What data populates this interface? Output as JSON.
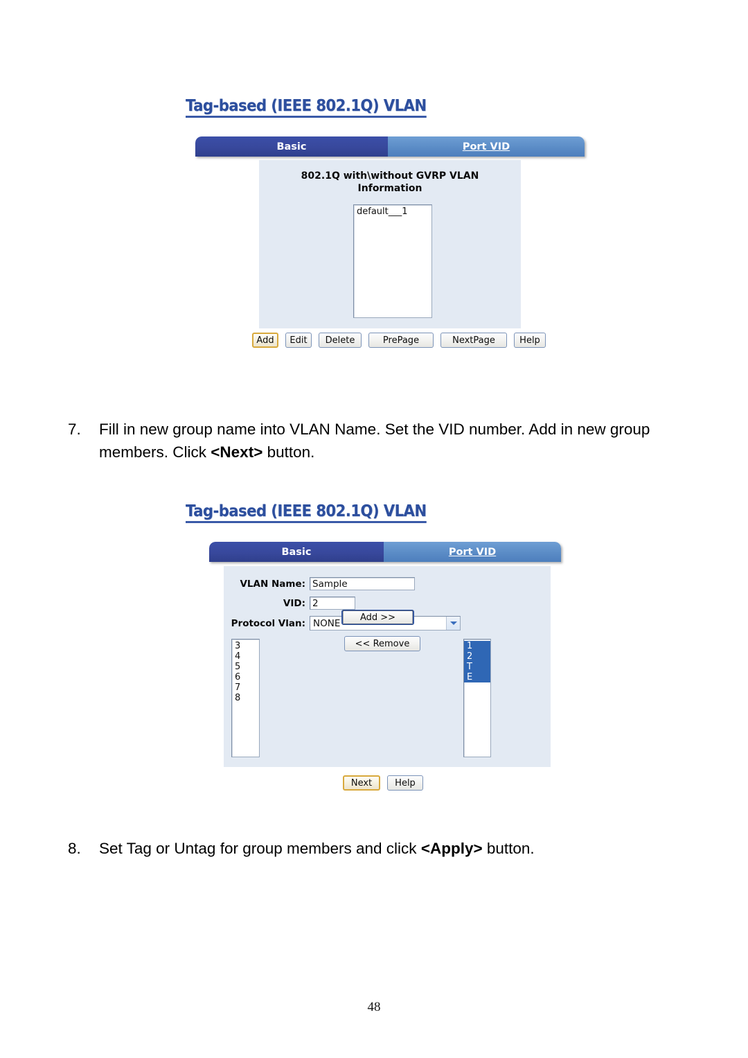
{
  "page": {
    "number": "48"
  },
  "figure1": {
    "title": "Tag-based (IEEE 802.1Q) VLAN",
    "tabs": [
      {
        "label": "Basic",
        "active": true
      },
      {
        "label": "Port VID",
        "active": false
      }
    ],
    "heading_line1": "802.1Q with\\without GVRP VLAN",
    "heading_line2": "Information",
    "list": {
      "items": [
        "default___1"
      ]
    },
    "buttons": [
      {
        "label": "Add",
        "focused": true
      },
      {
        "label": "Edit",
        "focused": false
      },
      {
        "label": "Delete",
        "focused": false
      },
      {
        "label": "PrePage",
        "focused": false
      },
      {
        "label": "NextPage",
        "focused": false
      },
      {
        "label": "Help",
        "focused": false
      }
    ]
  },
  "step7": {
    "number": "7.",
    "text_part1": "Fill in new group name into VLAN Name. Set the VID number. Add in new group members. Click ",
    "text_bold": "<Next>",
    "text_part2": " button."
  },
  "figure2": {
    "title": "Tag-based (IEEE 802.1Q) VLAN",
    "tabs": [
      {
        "label": "Basic",
        "active": true
      },
      {
        "label": "Port VID",
        "active": false
      }
    ],
    "fields": {
      "vlan_name_label": "VLAN Name:",
      "vlan_name_value": "Sample",
      "vid_label": "VID:",
      "vid_value": "2",
      "protocol_vlan_label": "Protocol Vlan:",
      "protocol_vlan_value": "NONE"
    },
    "available_list": {
      "items": [
        "3",
        "4",
        "5",
        "6",
        "7",
        "8"
      ]
    },
    "member_list": {
      "items": [
        {
          "label": "1",
          "selected": true
        },
        {
          "label": "2",
          "selected": true
        },
        {
          "label": "T",
          "selected": true
        },
        {
          "label": "E",
          "selected": true
        }
      ]
    },
    "transfer_buttons": {
      "add_label": "Add   >>",
      "remove_label": "<< Remove"
    },
    "buttons": [
      {
        "label": "Next",
        "focused": true
      },
      {
        "label": "Help",
        "focused": false
      }
    ]
  },
  "step8": {
    "number": "8.",
    "text_part1": "Set Tag or Untag for group members and click ",
    "text_bold": "<Apply>",
    "text_part2": " button."
  },
  "colors": {
    "tab_active": "#38489c",
    "tab_inactive": "#5b8cc6",
    "panel_bg": "#e3eaf3",
    "title_blue": "#2d4f9e",
    "selection_blue": "#2f67b5",
    "focus_gold": "#d8a93c"
  }
}
